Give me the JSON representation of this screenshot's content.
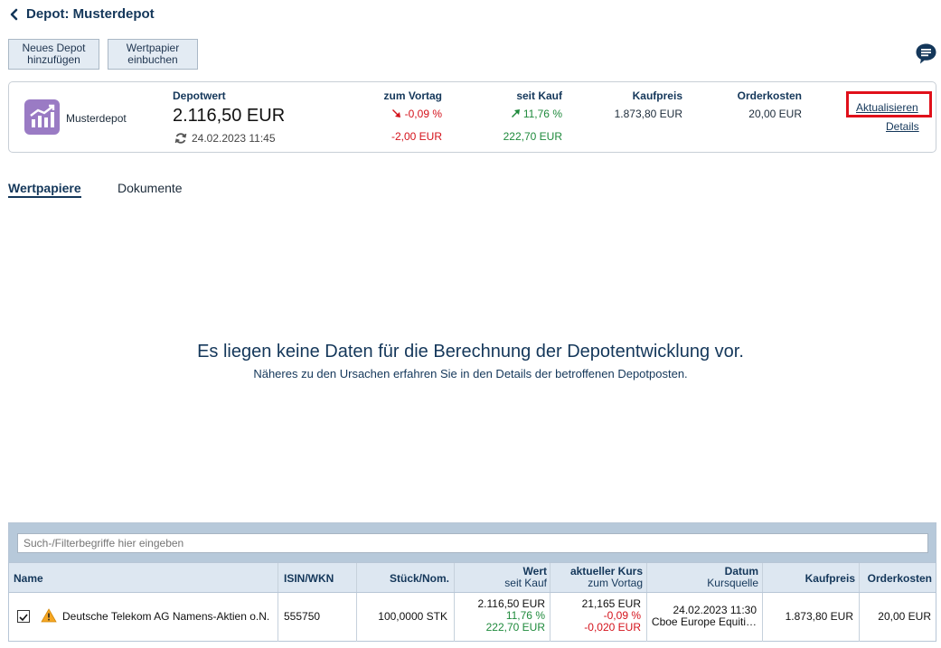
{
  "header": {
    "title": "Depot: Musterdepot"
  },
  "toolbar": {
    "new_depot_line1": "Neues Depot",
    "new_depot_line2": "hinzufügen",
    "book_security_line1": "Wertpapier",
    "book_security_line2": "einbuchen"
  },
  "summary": {
    "depot_name": "Musterdepot",
    "depotwert_label": "Depotwert",
    "depotwert_value": "2.116,50 EUR",
    "timestamp": "24.02.2023 11:45",
    "vortag_label": "zum Vortag",
    "vortag_pct": "-0,09 %",
    "vortag_abs": "-2,00 EUR",
    "seitkauf_label": "seit Kauf",
    "seitkauf_pct": "11,76 %",
    "seitkauf_abs": "222,70 EUR",
    "kaufpreis_label": "Kaufpreis",
    "kaufpreis_value": "1.873,80 EUR",
    "orderkosten_label": "Orderkosten",
    "orderkosten_value": "20,00 EUR",
    "update_link": "Aktualisieren",
    "details_link": "Details"
  },
  "tabs": [
    {
      "label": "Wertpapiere",
      "active": true
    },
    {
      "label": "Dokumente",
      "active": false
    }
  ],
  "empty_state": {
    "headline": "Es liegen keine Daten für die Berechnung der Depotentwicklung vor.",
    "subline": "Näheres zu den Ursachen erfahren Sie in den Details der betroffenen Depotposten."
  },
  "table": {
    "filter_placeholder": "Such-/Filterbegriffe hier eingeben",
    "columns": {
      "name": "Name",
      "isin": "ISIN/WKN",
      "stueck": "Stück/Nom.",
      "wert": "Wert",
      "wert_sub": "seit Kauf",
      "kurs": "aktueller Kurs",
      "kurs_sub": "zum Vortag",
      "datum": "Datum",
      "datum_sub": "Kursquelle",
      "kaufpreis": "Kaufpreis",
      "orderkosten": "Orderkosten"
    },
    "rows": [
      {
        "name": "Deutsche Telekom AG Namens-Aktien o.N.",
        "isin": "555750",
        "stueck": "100,0000 STK",
        "wert": "2.116,50 EUR",
        "wert_pct": "11,76 %",
        "wert_abs": "222,70 EUR",
        "kurs": "21,165 EUR",
        "kurs_pct": "-0,09 %",
        "kurs_abs": "-0,020 EUR",
        "datum": "24.02.2023 11:30",
        "kursquelle": "Cboe Europe Equiti…",
        "kaufpreis": "1.873,80 EUR",
        "orderkosten": "20,00 EUR"
      }
    ]
  },
  "colors": {
    "brand": "#14375a",
    "negative": "#d4121b",
    "positive": "#1f8a3c",
    "highlight": "#e0101a",
    "logo": "#9a7bc4"
  }
}
